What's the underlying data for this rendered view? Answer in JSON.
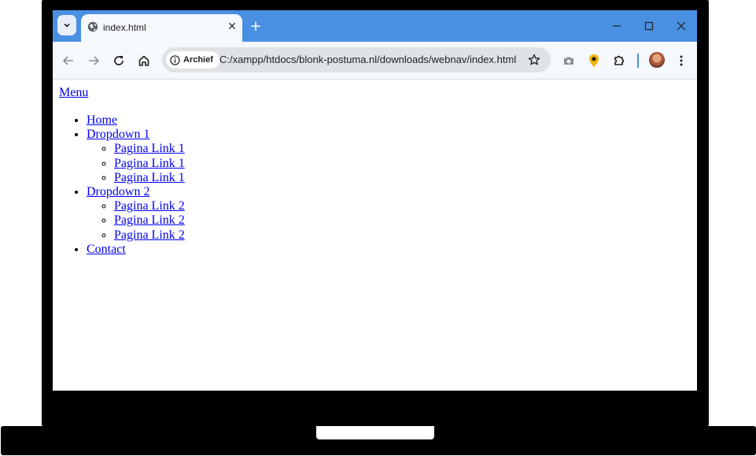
{
  "browser": {
    "tab_title": "index.html",
    "new_tab_label": "+",
    "close_tab_label": "✕",
    "security_chip": "Archief",
    "url": "C:/xampp/htdocs/blonk-postuma.nl/downloads/webnav/index.html"
  },
  "page": {
    "menu_label": "Menu",
    "nav": {
      "home": "Home",
      "dropdown1": {
        "label": "Dropdown 1",
        "items": [
          "Pagina Link 1",
          "Pagina Link 1",
          "Pagina Link 1"
        ]
      },
      "dropdown2": {
        "label": "Dropdown 2",
        "items": [
          "Pagina Link 2",
          "Pagina Link 2",
          "Pagina Link 2"
        ]
      },
      "contact": "Contact"
    }
  },
  "colors": {
    "tabstrip": "#4a90e2",
    "toolbar": "#f5f8fc",
    "link": "#0000ee",
    "frame": "#000000"
  },
  "icons": [
    "tab-search-icon",
    "globe-icon",
    "close-icon",
    "minimize-icon",
    "maximize-icon",
    "window-close-icon",
    "back-icon",
    "forward-icon",
    "reload-icon",
    "home-icon",
    "info-icon",
    "star-icon",
    "camera-icon",
    "location-icon",
    "extensions-icon",
    "menu-dots-icon"
  ]
}
